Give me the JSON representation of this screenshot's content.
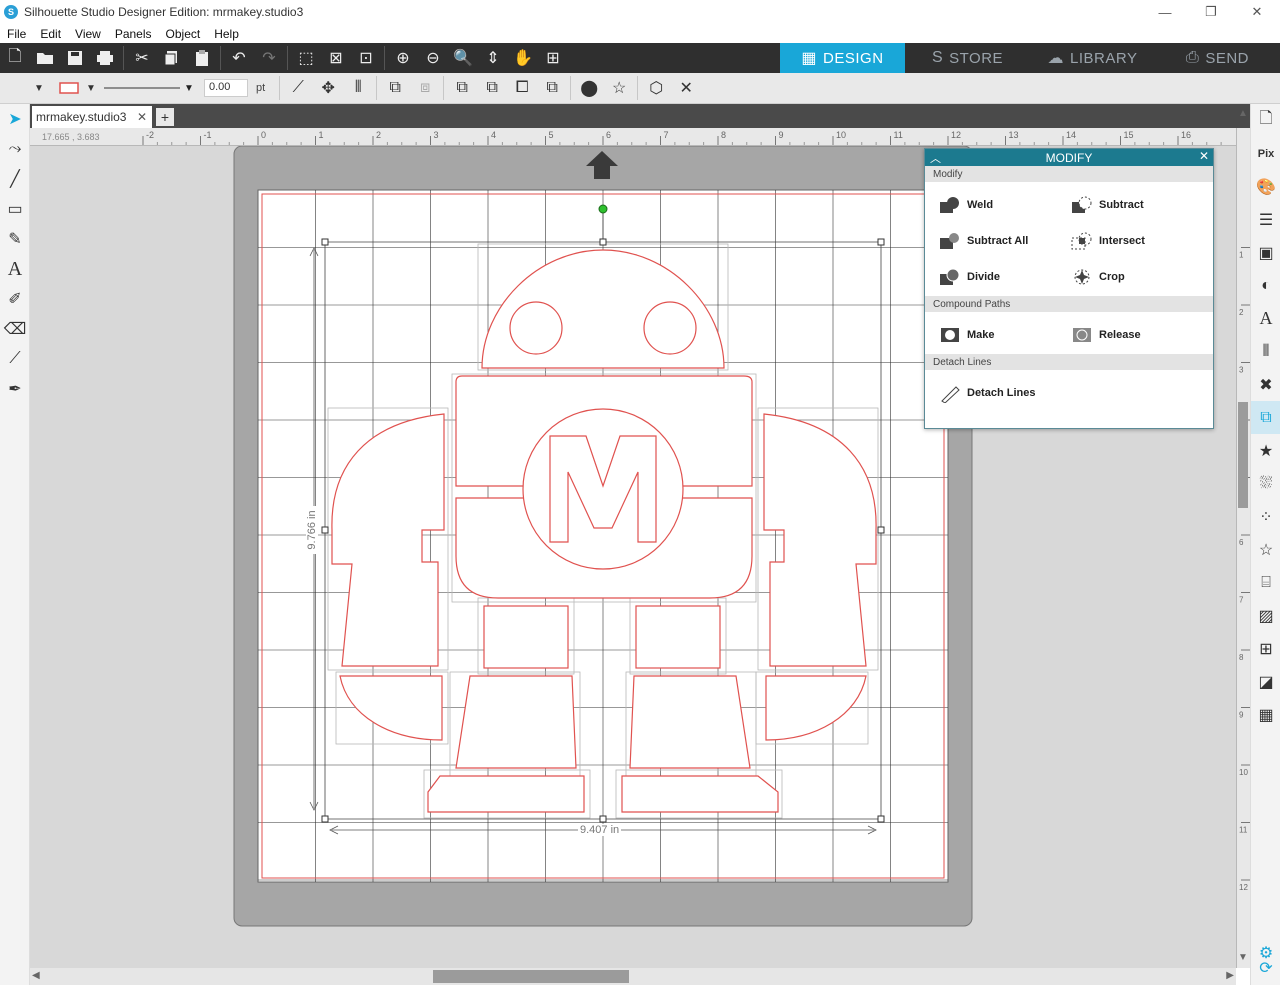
{
  "window": {
    "title": "Silhouette Studio Designer Edition: mrmakey.studio3",
    "minimize": "—",
    "restore": "❐",
    "close": "✕"
  },
  "menu": [
    "File",
    "Edit",
    "View",
    "Panels",
    "Object",
    "Help"
  ],
  "mode_tabs": [
    {
      "label": "DESIGN",
      "icon": "▦",
      "active": true
    },
    {
      "label": "STORE",
      "icon": "S",
      "active": false
    },
    {
      "label": "LIBRARY",
      "icon": "☁",
      "active": false
    },
    {
      "label": "SEND",
      "icon": "⎙",
      "active": false
    }
  ],
  "stroke": {
    "width": "0.00",
    "unit": "pt"
  },
  "document_tab": {
    "name": "mrmakey.studio3",
    "close": "✕",
    "add": "+"
  },
  "cursor_coords": "17.665 , 3.683",
  "ruler": {
    "h_ticks": [
      "-2",
      "-1",
      "0",
      "1",
      "2",
      "3",
      "4",
      "5",
      "6",
      "7",
      "8",
      "9",
      "10",
      "11",
      "12",
      "13",
      "14",
      "15",
      "16"
    ],
    "v_ticks": [
      "1",
      "2",
      "3",
      "4",
      "5",
      "6",
      "7",
      "8",
      "9",
      "10",
      "11",
      "12"
    ]
  },
  "dimensions": {
    "width": "9.407 in",
    "height": "9.766 in"
  },
  "modify_panel": {
    "title": "MODIFY",
    "sections": [
      {
        "heading": "Modify",
        "items": [
          {
            "label": "Weld",
            "icon": "weld-icon"
          },
          {
            "label": "Subtract",
            "icon": "subtract-icon"
          },
          {
            "label": "Subtract All",
            "icon": "subtract-all-icon"
          },
          {
            "label": "Intersect",
            "icon": "intersect-icon"
          },
          {
            "label": "Divide",
            "icon": "divide-icon"
          },
          {
            "label": "Crop",
            "icon": "crop-icon"
          }
        ]
      },
      {
        "heading": "Compound Paths",
        "items": [
          {
            "label": "Make",
            "icon": "make-compound-icon"
          },
          {
            "label": "Release",
            "icon": "release-compound-icon"
          }
        ]
      },
      {
        "heading": "Detach Lines",
        "items": [
          {
            "label": "Detach Lines",
            "icon": "detach-lines-icon"
          }
        ]
      }
    ]
  },
  "colors": {
    "accent": "#19a7d8",
    "panel_header": "#1c7a8f",
    "cut_line": "#e0524f",
    "mat": "#a6a6a6"
  }
}
